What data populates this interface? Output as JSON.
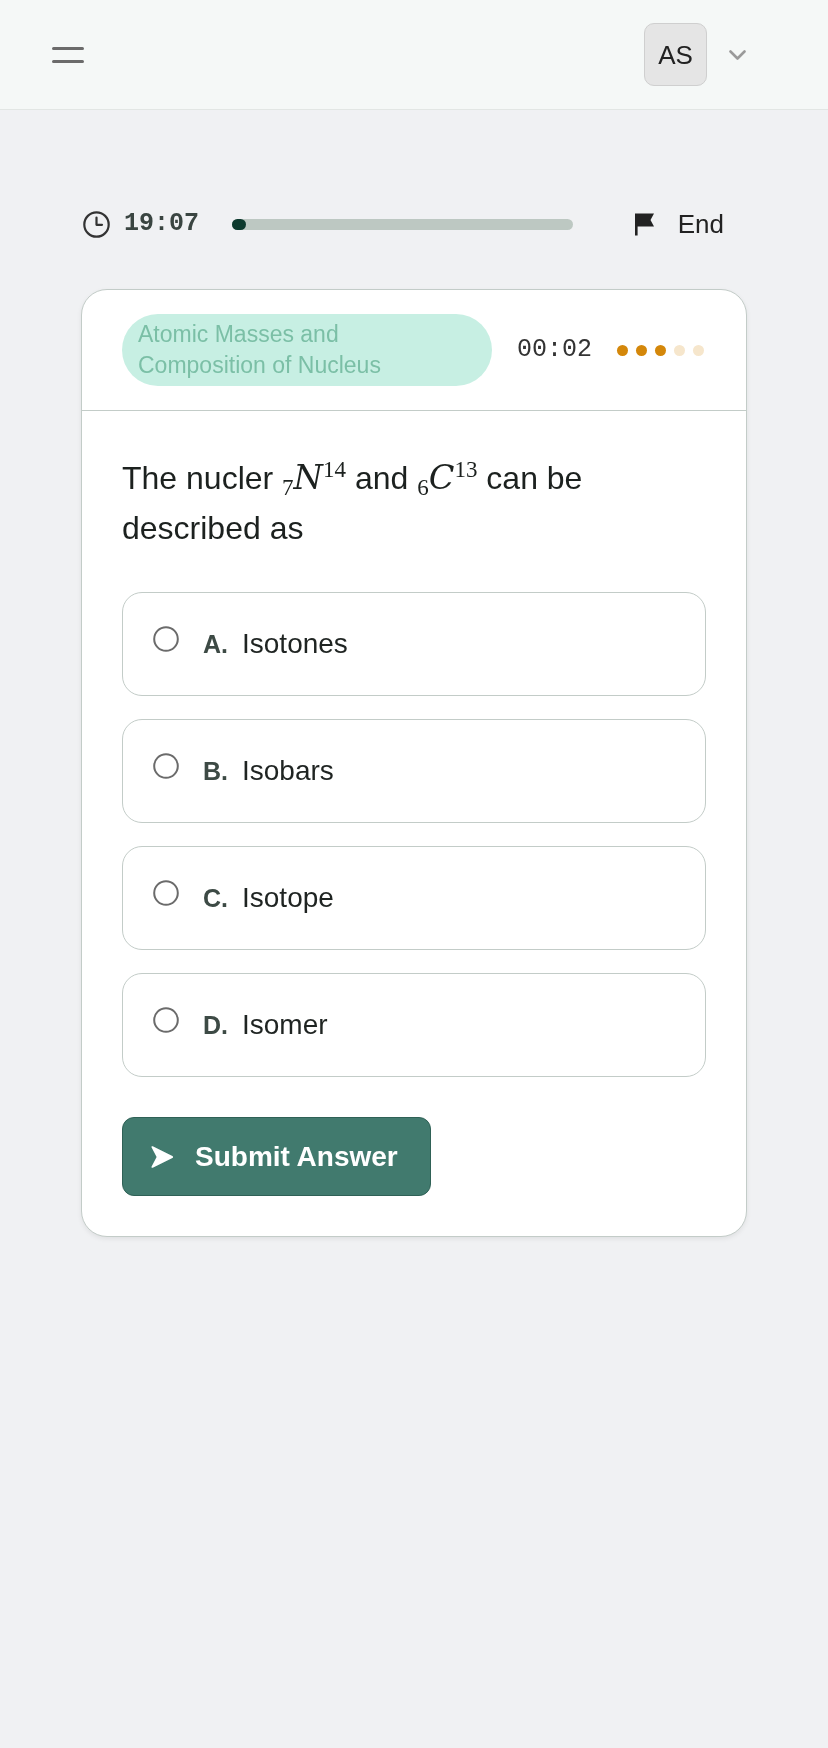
{
  "header": {
    "avatar_initials": "AS"
  },
  "quiz_bar": {
    "time_left": "19:07",
    "progress": {
      "level": 0.04
    },
    "end_label": "End"
  },
  "question_card": {
    "topic": "Atomic Masses and Composition of Nucleus",
    "elapsed": "00:02",
    "difficulty_dots": [
      {
        "filled": true
      },
      {
        "filled": true
      },
      {
        "filled": true
      },
      {
        "filled": false
      },
      {
        "filled": false
      }
    ],
    "question": "The nucler $_{7}$*N*$^{14}$ and $_{6}$*C*$^{13}$ can be described as",
    "options": [
      {
        "letter": "A.",
        "text": "Isotones",
        "selected": false
      },
      {
        "letter": "B.",
        "text": "Isobars",
        "selected": false
      },
      {
        "letter": "C.",
        "text": "Isotope",
        "selected": false
      },
      {
        "letter": "D.",
        "text": "Isomer",
        "selected": false
      }
    ],
    "submit_label": "Submit Answer"
  }
}
